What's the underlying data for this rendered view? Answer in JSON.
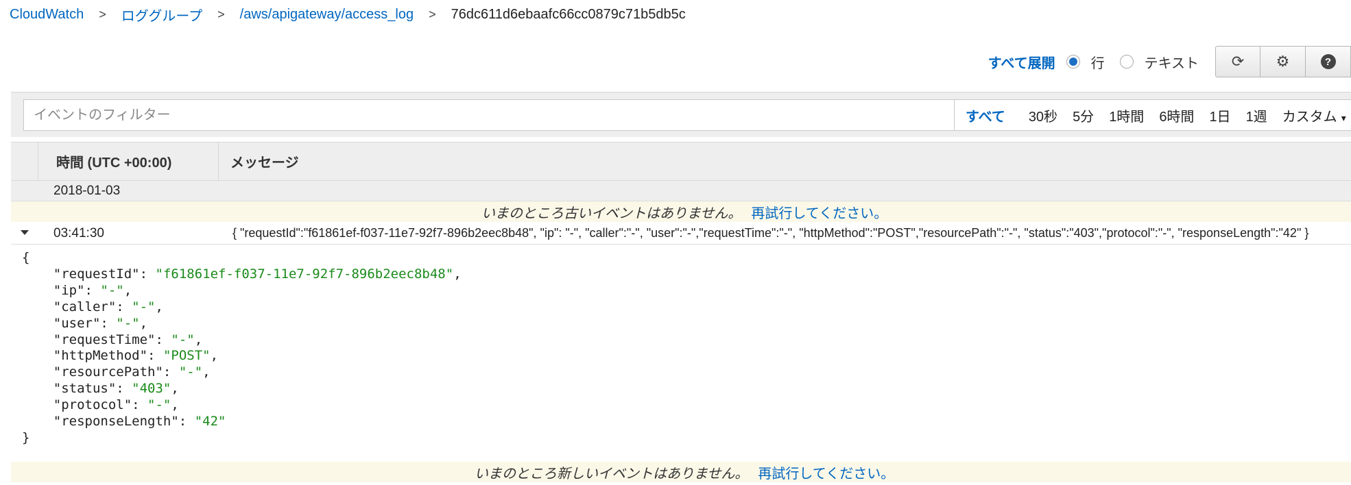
{
  "breadcrumb": {
    "items": [
      "CloudWatch",
      "ロググループ",
      "/aws/apigateway/access_log"
    ],
    "current": "76dc611d6ebaafc66cc0879c71b5db5c",
    "separator": ">"
  },
  "view_options": {
    "expand_all": "すべて展開",
    "radio_rows": "行",
    "radio_text": "テキスト",
    "selected": "行"
  },
  "toolbar": {
    "icons": [
      "refresh-icon",
      "gear-icon",
      "help-icon"
    ],
    "refresh_glyph": "⟳",
    "gear_glyph": "⚙",
    "help_glyph": "?"
  },
  "filter": {
    "placeholder": "イベントのフィルター",
    "value": ""
  },
  "time_ranges": {
    "active": "すべて",
    "options": [
      "30秒",
      "5分",
      "1時間",
      "6時間",
      "1日",
      "1週",
      "カスタム"
    ],
    "caret": "▾"
  },
  "table": {
    "col_time": "時間 (UTC +00:00)",
    "col_message": "メッセージ"
  },
  "date_group": "2018-01-03",
  "notice_old": {
    "text": "いまのところ古いイベントはありません。",
    "link": "再試行してください。"
  },
  "event": {
    "time": "03:41:30",
    "message": "{ \"requestId\":\"f61861ef-f037-11e7-92f7-896b2eec8b48\", \"ip\": \"-\", \"caller\":\"-\", \"user\":\"-\",\"requestTime\":\"-\", \"httpMethod\":\"POST\",\"resourcePath\":\"-\", \"status\":\"403\",\"protocol\":\"-\", \"responseLength\":\"42\" }"
  },
  "json_detail": {
    "open": "{",
    "close": "}",
    "fields": [
      {
        "key": "\"requestId\"",
        "value": "\"f61861ef-f037-11e7-92f7-896b2eec8b48\"",
        "comma": ","
      },
      {
        "key": "\"ip\"",
        "value": "\"-\"",
        "comma": ","
      },
      {
        "key": "\"caller\"",
        "value": "\"-\"",
        "comma": ","
      },
      {
        "key": "\"user\"",
        "value": "\"-\"",
        "comma": ","
      },
      {
        "key": "\"requestTime\"",
        "value": "\"-\"",
        "comma": ","
      },
      {
        "key": "\"httpMethod\"",
        "value": "\"POST\"",
        "comma": ","
      },
      {
        "key": "\"resourcePath\"",
        "value": "\"-\"",
        "comma": ","
      },
      {
        "key": "\"status\"",
        "value": "\"403\"",
        "comma": ","
      },
      {
        "key": "\"protocol\"",
        "value": "\"-\"",
        "comma": ","
      },
      {
        "key": "\"responseLength\"",
        "value": "\"42\"",
        "comma": ""
      }
    ]
  },
  "notice_new": {
    "text": "いまのところ新しいイベントはありません。",
    "link": "再試行してください。"
  },
  "colors": {
    "link": "#0066c0",
    "json_string": "#1a8a1a",
    "notice_bg": "#fbf8e8",
    "header_bg": "#eeeeee"
  }
}
